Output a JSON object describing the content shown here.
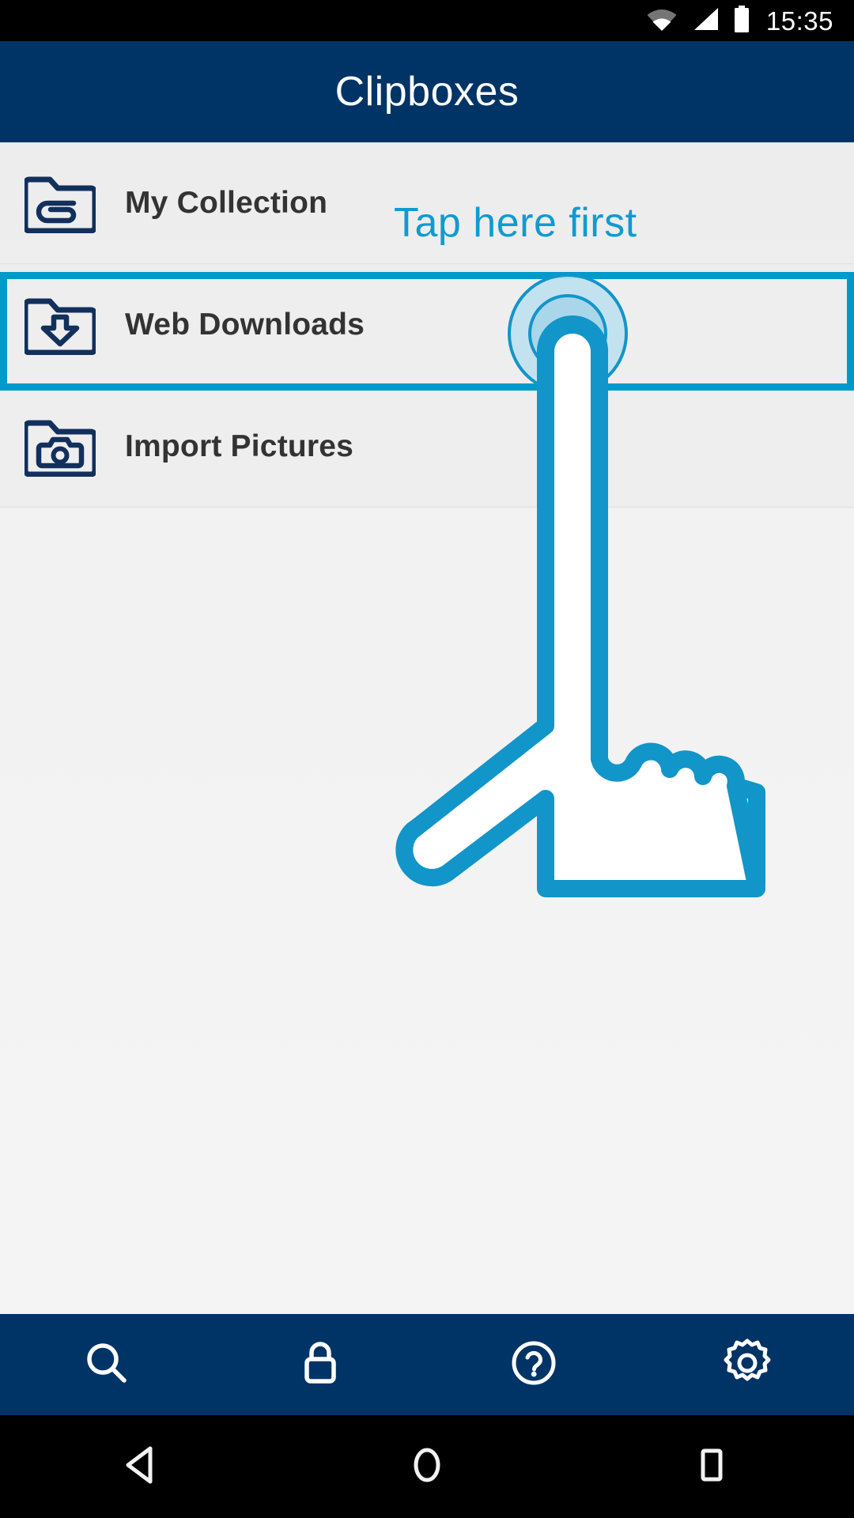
{
  "status_bar": {
    "time": "15:35",
    "icons": [
      "wifi-icon",
      "cellular-signal-icon",
      "battery-icon"
    ]
  },
  "app_bar": {
    "title": "Clipboxes"
  },
  "coach_mark": {
    "text": "Tap here first",
    "color": "#0f9bd0",
    "target_row": "Web Downloads",
    "pointer": "tap-hand-pointer"
  },
  "list": {
    "items": [
      {
        "label": "My Collection",
        "icon": "folder-paperclip-icon",
        "highlighted": false
      },
      {
        "label": "Web Downloads",
        "icon": "folder-download-icon",
        "highlighted": true
      },
      {
        "label": "Import Pictures",
        "icon": "folder-camera-icon",
        "highlighted": false
      }
    ]
  },
  "bottom_bar": {
    "buttons": [
      {
        "name": "search",
        "icon": "search-icon"
      },
      {
        "name": "lock",
        "icon": "lock-icon"
      },
      {
        "name": "help",
        "icon": "help-circle-icon"
      },
      {
        "name": "settings",
        "icon": "gear-icon"
      }
    ]
  },
  "nav_bar": {
    "buttons": [
      {
        "name": "back",
        "icon": "back-triangle-icon"
      },
      {
        "name": "home",
        "icon": "home-circle-icon"
      },
      {
        "name": "recents",
        "icon": "recents-square-icon"
      }
    ]
  },
  "colors": {
    "app_bar": "#003366",
    "accent": "#0099cc",
    "coach_text": "#0f9bd0",
    "icon_navy": "#12305c",
    "list_background": "#efefef",
    "label_text": "#333333"
  }
}
